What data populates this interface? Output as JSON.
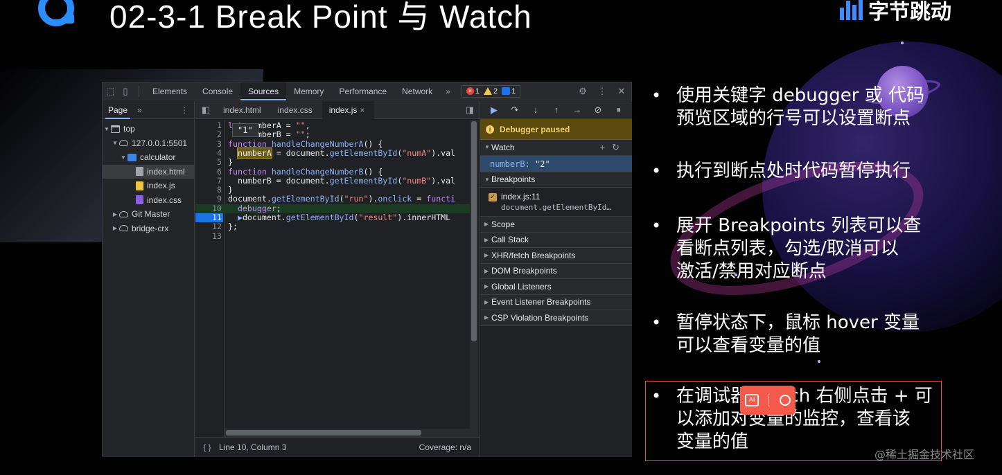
{
  "slide": {
    "title": "02-3-1 Break Point 与 Watch",
    "brand": "字节跳动",
    "credit": "@稀土掘金技术社区"
  },
  "colors": {
    "accent": "#8ab4f8",
    "paused": "#5b4a0e",
    "brand_blue": "#3c8cff"
  },
  "devtools": {
    "tabs": [
      "Elements",
      "Console",
      "Sources",
      "Memory",
      "Performance",
      "Network"
    ],
    "active_tab": "Sources",
    "badges": {
      "errors": "1",
      "warnings": "2",
      "messages": "1"
    },
    "navigator": {
      "tab": "Page",
      "tree": [
        {
          "label": "top",
          "depth": 0,
          "icon": "frame-icon",
          "expanded": true
        },
        {
          "label": "127.0.0.1:5501",
          "depth": 1,
          "icon": "cloud-icon",
          "expanded": true
        },
        {
          "label": "calculator",
          "depth": 2,
          "icon": "folder-icon",
          "expanded": true
        },
        {
          "label": "index.html",
          "depth": 3,
          "icon": "file-html-icon",
          "selected": true
        },
        {
          "label": "index.js",
          "depth": 3,
          "icon": "file-js-icon"
        },
        {
          "label": "index.css",
          "depth": 3,
          "icon": "file-css-icon"
        },
        {
          "label": "Git Master",
          "depth": 0,
          "icon": "cloud-icon",
          "expanded": false
        },
        {
          "label": "bridge-crx",
          "depth": 0,
          "icon": "cloud-icon",
          "expanded": false
        }
      ]
    },
    "editor": {
      "tabs": [
        "index.html",
        "index.css",
        "index.js"
      ],
      "active_tab": "index.js",
      "hover_value": "\"1\"",
      "status": {
        "position": "Line 10, Column 3",
        "coverage": "Coverage: n/a"
      }
    },
    "debugger": {
      "paused_message": "Debugger paused",
      "sections": {
        "watch": "Watch",
        "breakpoints": "Breakpoints",
        "scope": "Scope",
        "call_stack": "Call Stack",
        "xhr": "XHR/fetch Breakpoints",
        "dom": "DOM Breakpoints",
        "global": "Global Listeners",
        "event": "Event Listener Breakpoints",
        "csp": "CSP Violation Breakpoints"
      },
      "watch_item": {
        "name": "numberB",
        "value": "\"2\""
      },
      "breakpoint": {
        "file": "index.js:11",
        "code": "document.getElementById…"
      }
    }
  },
  "bullets": [
    {
      "line1": "使用关键字 debugger 或 代码",
      "line2": "预览区域的行号可以设置断点"
    },
    {
      "line1": "执行到断点处时代码暂停执行",
      "line2": ""
    },
    {
      "line1": "展开 Breakpoints 列表可以查",
      "line2": "看断点列表，勾选/取消可以",
      "line3": "激活/禁用对应断点"
    },
    {
      "line1": "暂停状态下，鼠标 hover 变量",
      "line2": "可以查看变量的值"
    },
    {
      "line1": "在调试器 Watch 右侧点击 + 可",
      "line2": "以添加对变量的监控，查看该",
      "line3": "变量的值"
    }
  ]
}
